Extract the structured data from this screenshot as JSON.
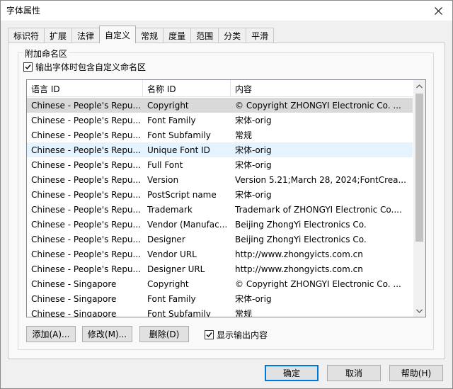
{
  "window": {
    "title": "字体属性"
  },
  "tabs": [
    {
      "label": "标识符"
    },
    {
      "label": "扩展"
    },
    {
      "label": "法律"
    },
    {
      "label": "自定义"
    },
    {
      "label": "常规"
    },
    {
      "label": "度量"
    },
    {
      "label": "范围"
    },
    {
      "label": "分类"
    },
    {
      "label": "平滑"
    }
  ],
  "active_tab": "自定义",
  "group": {
    "legend": "附加命名区",
    "include_checkbox": {
      "label": "输出字体时包含自定义命名区",
      "checked": true
    }
  },
  "table": {
    "columns": [
      "语言 ID",
      "名称 ID",
      "内容"
    ],
    "rows": [
      [
        "Chinese - People's Repu...",
        "Copyright",
        "© Copyright ZHONGYI Electronic Co. ..."
      ],
      [
        "Chinese - People's Repu...",
        "Font Family",
        "宋体-orig"
      ],
      [
        "Chinese - People's Repu...",
        "Font Subfamily",
        "常规"
      ],
      [
        "Chinese - People's Repu...",
        "Unique Font ID",
        "宋体-orig"
      ],
      [
        "Chinese - People's Repu...",
        "Full Font",
        "宋体-orig"
      ],
      [
        "Chinese - People's Repu...",
        "Version",
        "Version 5.21;March 28, 2024;FontCrea..."
      ],
      [
        "Chinese - People's Repu...",
        "PostScript name",
        "宋体-orig"
      ],
      [
        "Chinese - People's Repu...",
        "Trademark",
        "Trademark of ZHONGYI Electronic Co...."
      ],
      [
        "Chinese - People's Repu...",
        "Vendor (Manufac...",
        "Beijing ZhongYi Electronics Co."
      ],
      [
        "Chinese - People's Repu...",
        "Designer",
        "Beijing ZhongYi Electronics Co."
      ],
      [
        "Chinese - People's Repu...",
        "Vendor URL",
        "http://www.zhongyicts.com.cn"
      ],
      [
        "Chinese - People's Repu...",
        "Designer URL",
        "http://www.zhongyicts.com.cn"
      ],
      [
        "Chinese - Singapore",
        "Copyright",
        "© Copyright ZHONGYI Electronic Co. ..."
      ],
      [
        "Chinese - Singapore",
        "Font Family",
        "宋体-orig"
      ],
      [
        "Chinese - Singapore",
        "Font Subfamily",
        "常规"
      ]
    ],
    "selected_row": 0,
    "hover_row": 3
  },
  "buttons": {
    "add": "添加(A)...",
    "modify": "修改(M)...",
    "delete": "删除(D)",
    "show_output_label": "显示输出内容",
    "show_output_checked": true,
    "ok": "确定",
    "cancel": "取消",
    "help": "帮助(H)"
  },
  "icons": [
    "close-icon",
    "check-icon",
    "scroll-up-icon",
    "scroll-down-icon"
  ]
}
